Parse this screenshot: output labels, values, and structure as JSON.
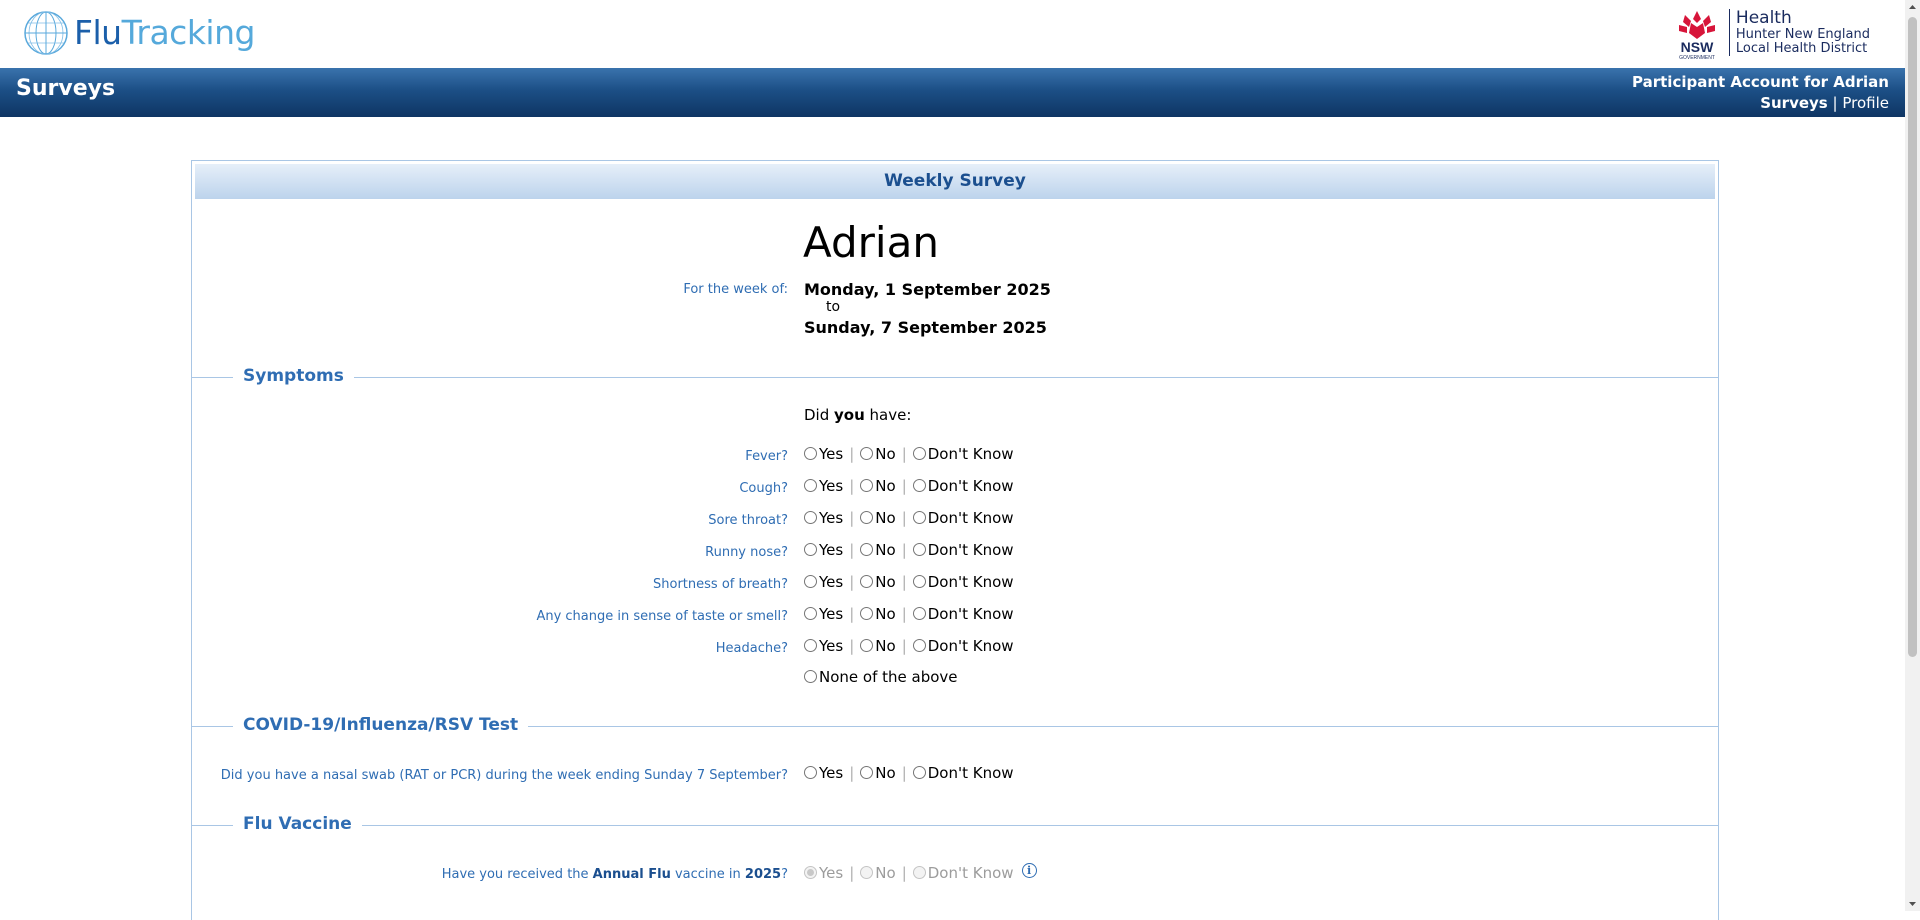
{
  "brand": {
    "flutracking_part1": "Flu",
    "flutracking_part2": "Tracking",
    "nsw_label": "NSW",
    "nsw_government": "GOVERNMENT",
    "health_title": "Health",
    "district_line1": "Hunter New England",
    "district_line2": "Local Health District"
  },
  "header": {
    "title": "Surveys",
    "account_label": "Participant Account for Adrian",
    "nav": {
      "surveys": "Surveys",
      "separator": "|",
      "profile": "Profile"
    }
  },
  "survey": {
    "heading": "Weekly Survey",
    "participant_name": "Adrian",
    "week_label": "For the week of:",
    "week_start": "Monday, 1 September 2025",
    "week_to": "to",
    "week_end": "Sunday, 7 September 2025",
    "symptoms": {
      "section_title": "Symptoms",
      "prompt_pre": "Did ",
      "prompt_bold": "you",
      "prompt_post": " have:",
      "questions": [
        {
          "label": "Fever?"
        },
        {
          "label": "Cough?"
        },
        {
          "label": "Sore throat?"
        },
        {
          "label": "Runny nose?"
        },
        {
          "label": "Shortness of breath?"
        },
        {
          "label": "Any change in sense of taste or smell?"
        },
        {
          "label": "Headache?"
        }
      ],
      "none_option": "None of the above"
    },
    "options": {
      "yes": "Yes",
      "no": "No",
      "dont_know": "Don't Know",
      "separator": "|"
    },
    "test": {
      "section_title": "COVID-19/Influenza/RSV Test",
      "question": "Did you have a nasal swab (RAT or PCR) during the week ending Sunday 7 September?"
    },
    "vaccine": {
      "section_title": "Flu Vaccine",
      "question_pre": "Have you received the ",
      "question_bold": "Annual Flu",
      "question_mid": " vaccine in ",
      "question_year": "2025",
      "question_post": "?",
      "selected": "Yes",
      "info_icon": "i"
    }
  },
  "colors": {
    "header_dark": "#0e3563",
    "header_light": "#3a73ad",
    "label_blue": "#2f6db3",
    "panel_border": "#a9c6e5"
  }
}
